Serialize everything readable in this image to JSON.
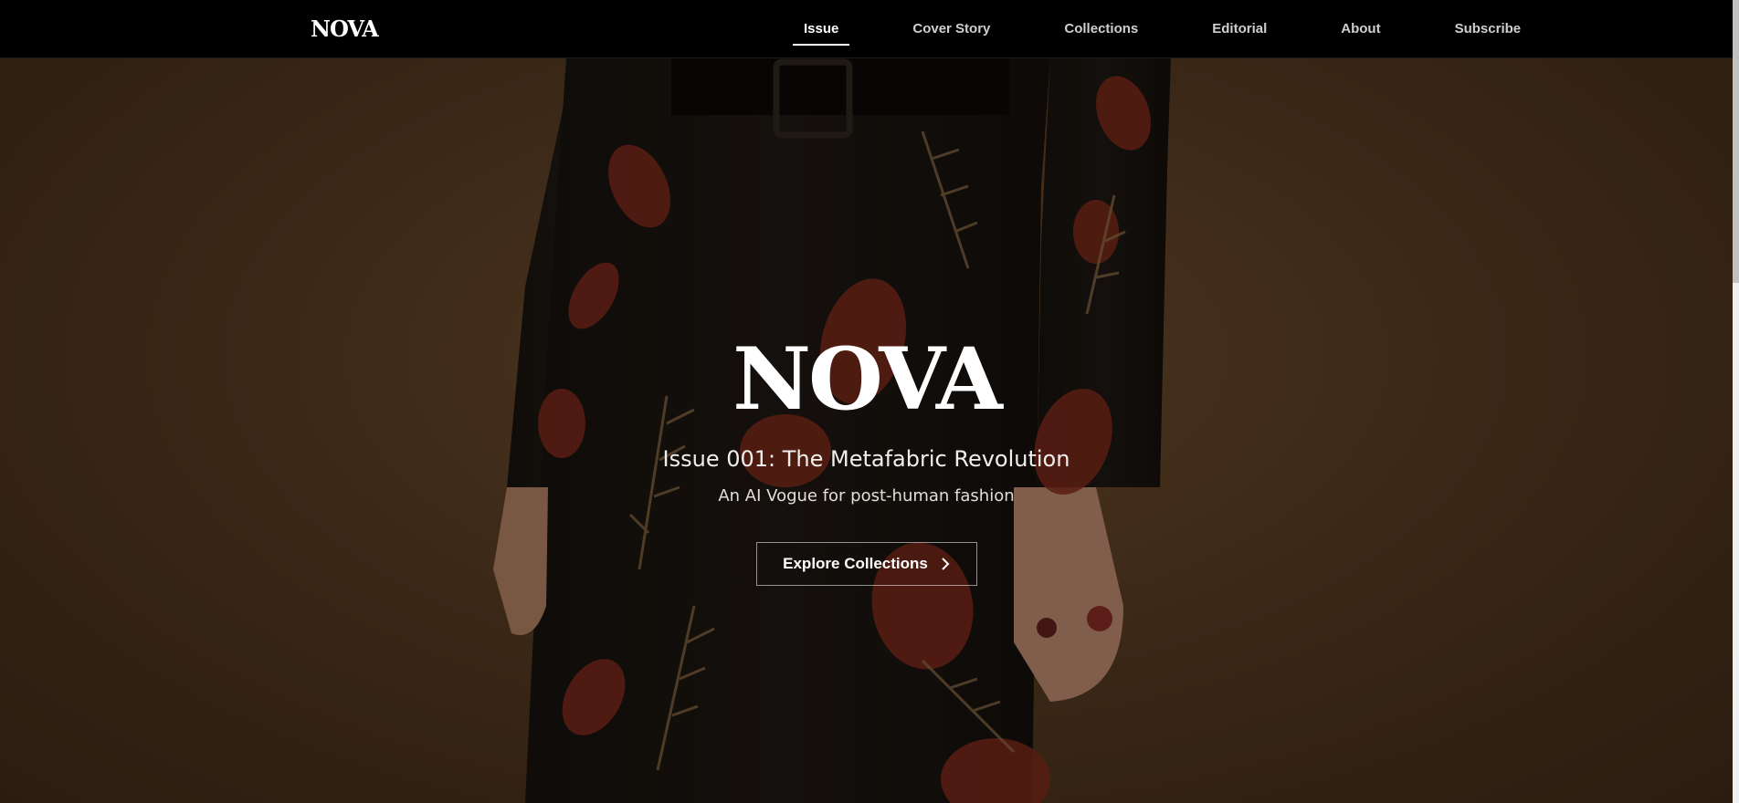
{
  "nav": {
    "logo": "NOVA",
    "links": [
      "Issue",
      "Cover Story",
      "Collections",
      "Editorial",
      "About",
      "Subscribe"
    ],
    "active": "Issue"
  },
  "hero": {
    "title": "NOVA",
    "issue": "Issue 001: The Metafabric Revolution",
    "tagline": "An AI Vogue for post-human fashion",
    "button_label": "Explore Collections",
    "button_icon": "chevron-right-icon"
  },
  "colors": {
    "nav_bg": "#000000",
    "hero_bg": "#4f361f",
    "text": "#ffffff"
  }
}
